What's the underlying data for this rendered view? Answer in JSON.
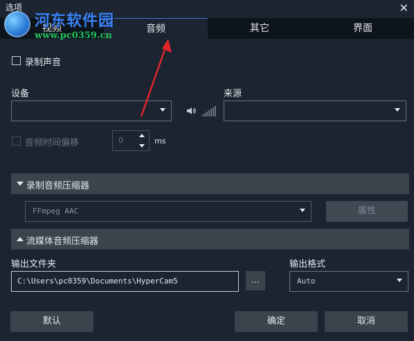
{
  "window": {
    "title": "选项",
    "close_glyph": "✕"
  },
  "watermark": {
    "brand": "河东软件园",
    "url": "www.pc0359.cn"
  },
  "tabs": [
    {
      "label": "视频",
      "active": false
    },
    {
      "label": "音频",
      "active": true
    },
    {
      "label": "其它",
      "active": false
    },
    {
      "label": "界面",
      "active": false
    }
  ],
  "record_audio": {
    "label": "录制声音",
    "checked": false
  },
  "device": {
    "label": "设备",
    "value": ""
  },
  "source": {
    "label": "来源",
    "value": ""
  },
  "offset": {
    "label": "音频时间偏移",
    "value": "0",
    "unit": "ms",
    "checked": false
  },
  "record_compressor": {
    "label": "录制音频压缩器",
    "codec": "FFmpeg AAC",
    "properties_label": "属性"
  },
  "stream_compressor": {
    "label": "流媒体音频压缩器"
  },
  "output_folder": {
    "label": "输出文件夹",
    "value": "C:\\Users\\pc0359\\Documents\\HyperCam5",
    "browse_label": "..."
  },
  "output_format": {
    "label": "输出格式",
    "value": "Auto"
  },
  "buttons": {
    "default": "默认",
    "ok": "确定",
    "cancel": "取消"
  },
  "icons": {
    "close": "close-icon",
    "speaker": "speaker-icon",
    "level": "level-meter-icon"
  },
  "colors": {
    "background": "#1b2430",
    "tab_inactive": "#0e141b",
    "panel": "#3b434d",
    "accent": "#3e76d6",
    "annotation_arrow": "#e0262b"
  }
}
